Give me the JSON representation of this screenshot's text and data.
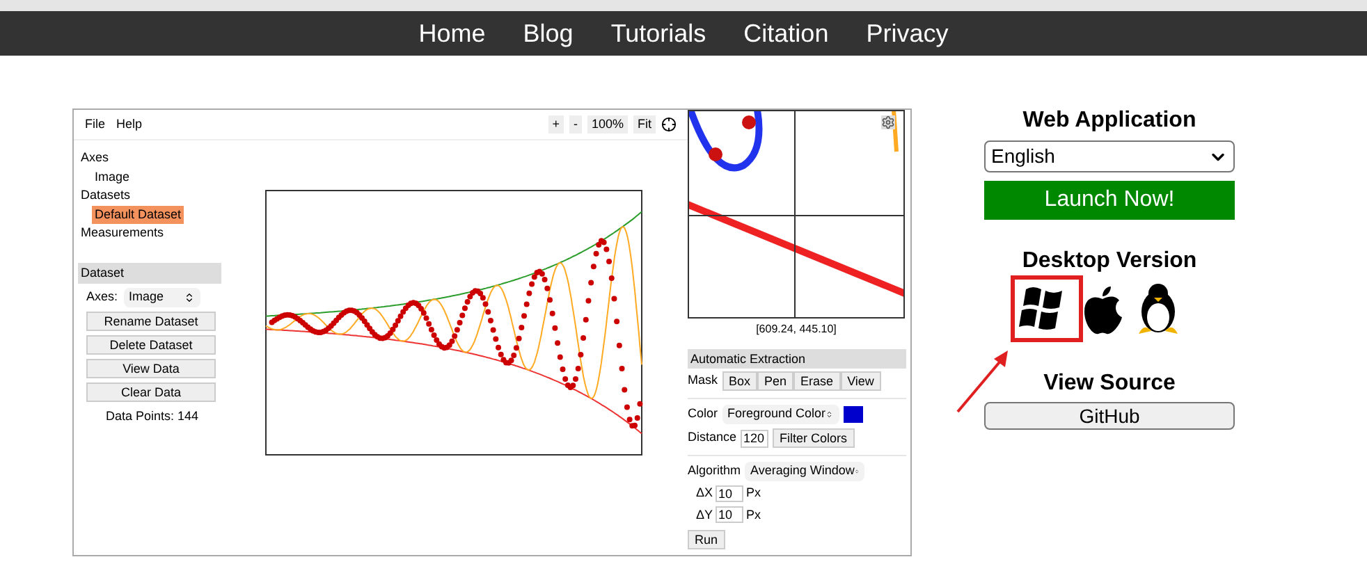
{
  "nav": [
    {
      "label": "Home"
    },
    {
      "label": "Blog"
    },
    {
      "label": "Tutorials"
    },
    {
      "label": "Citation"
    },
    {
      "label": "Privacy"
    }
  ],
  "app": {
    "menu": [
      "File",
      "Help"
    ],
    "zoom_controls": [
      "+",
      "-",
      "100%",
      "Fit"
    ],
    "tree": [
      {
        "label": "Axes",
        "selected": false,
        "children": [
          {
            "label": "Image",
            "selected": false
          }
        ]
      },
      {
        "label": "Datasets",
        "selected": false,
        "children": [
          {
            "label": "Default Dataset",
            "selected": true
          }
        ]
      },
      {
        "label": "Measurements",
        "selected": false
      }
    ],
    "dataset_panel": {
      "title": "Dataset",
      "axes_label": "Axes:",
      "axes_value": "Image",
      "buttons": [
        "Rename Dataset",
        "Delete Dataset",
        "View Data",
        "Clear Data"
      ],
      "points": "Data Points: 144"
    },
    "zoom_view": {
      "coords": "[609.24, 445.10]"
    },
    "extraction": {
      "title": "Automatic Extraction",
      "mask_label": "Mask",
      "mask_buttons": [
        "Box",
        "Pen",
        "Erase",
        "View"
      ],
      "color_label": "Color",
      "color_value": "Foreground Color",
      "color": "#0000cc",
      "distance_label": "Distance",
      "distance_value": "120",
      "filter_button": "Filter Colors",
      "algorithm_label": "Algorithm",
      "algorithm_value": "Averaging Window",
      "params": [
        {
          "label": "ΔX",
          "value": "10",
          "unit": "Px"
        },
        {
          "label": "ΔY",
          "value": "10",
          "unit": "Px"
        }
      ],
      "run": "Run"
    }
  },
  "sidebar": {
    "web_title": "Web Application",
    "language": "English",
    "launch": "Launch Now!",
    "desktop_title": "Desktop Version",
    "source_title": "View Source",
    "github": "GitHub"
  }
}
